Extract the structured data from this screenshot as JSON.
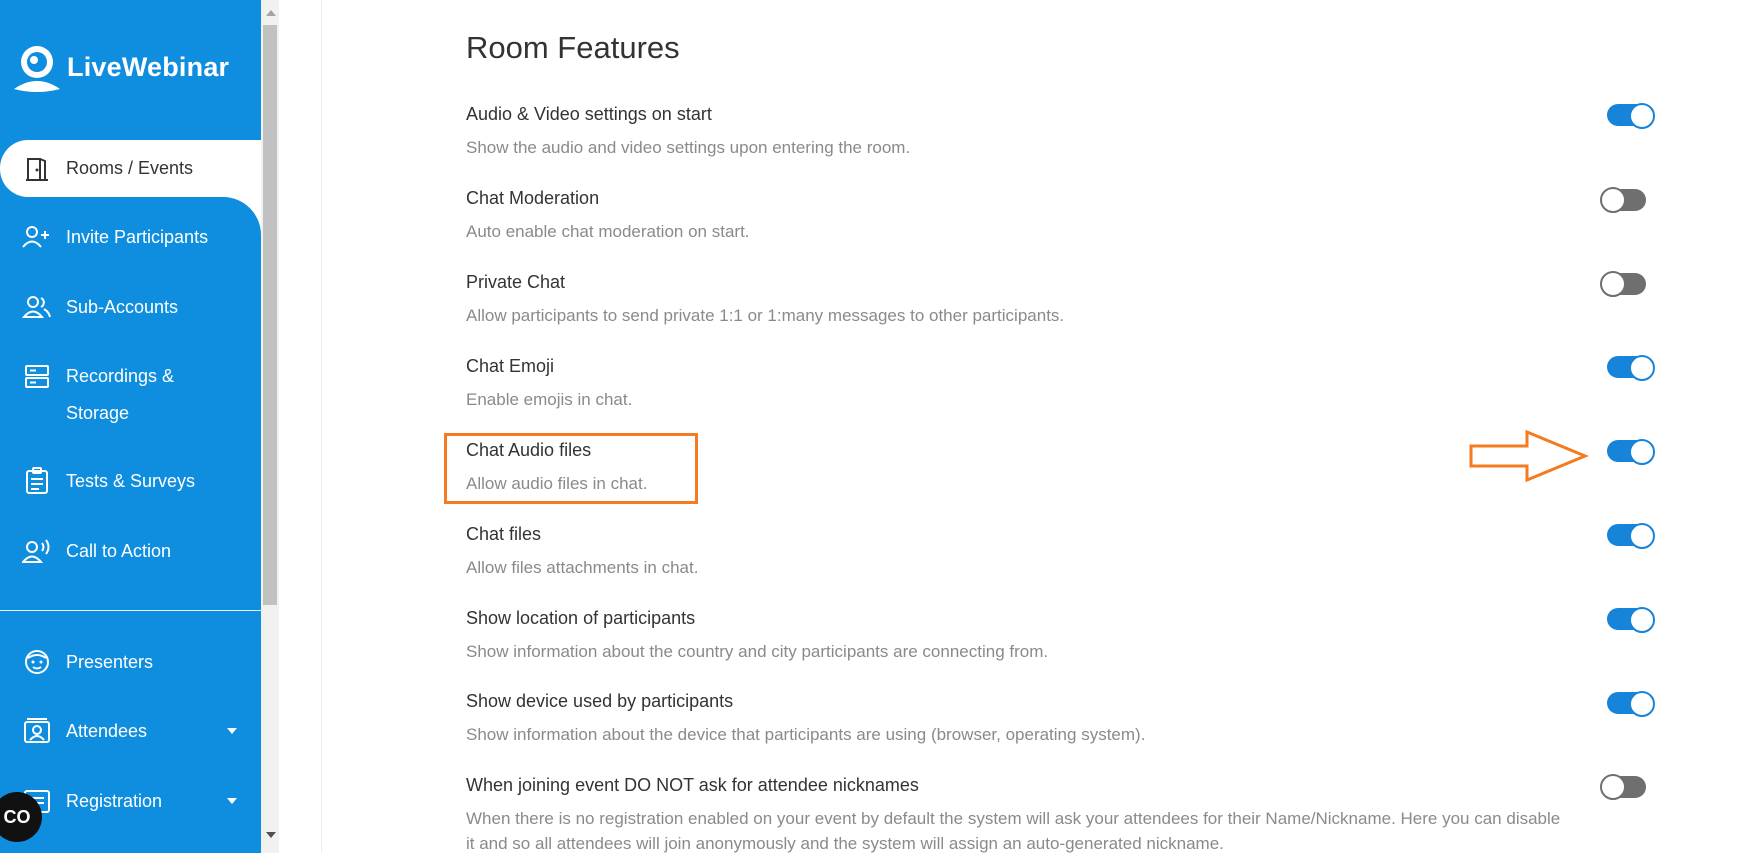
{
  "brand": {
    "name": "LiveWebinar"
  },
  "sidebar": {
    "items": [
      {
        "label": "Rooms / Events",
        "icon": "door-icon",
        "active": true
      },
      {
        "label": "Invite Participants",
        "icon": "add-user-icon"
      },
      {
        "label": "Sub-Accounts",
        "icon": "users-icon"
      },
      {
        "label": "Recordings &",
        "label2": "Storage",
        "icon": "storage-icon"
      },
      {
        "label": "Tests & Surveys",
        "icon": "clipboard-icon"
      },
      {
        "label": "Call to Action",
        "icon": "speaker-user-icon"
      },
      {
        "label": "Presenters",
        "icon": "presenter-icon"
      },
      {
        "label": "Attendees",
        "icon": "attendee-icon"
      },
      {
        "label": "Registration",
        "icon": "registration-icon"
      }
    ],
    "chat_widget": "CO"
  },
  "main": {
    "title": "Room Features",
    "features": [
      {
        "title": "Audio & Video settings on start",
        "desc": "Show the audio and video settings upon entering the room.",
        "enabled": true
      },
      {
        "title": "Chat Moderation",
        "desc": "Auto enable chat moderation on start.",
        "enabled": false
      },
      {
        "title": "Private Chat",
        "desc": "Allow participants to send private 1:1 or 1:many messages to other participants.",
        "enabled": false
      },
      {
        "title": "Chat Emoji",
        "desc": "Enable emojis in chat.",
        "enabled": true
      },
      {
        "title": "Chat Audio files",
        "desc": "Allow audio files in chat.",
        "enabled": true
      },
      {
        "title": "Chat files",
        "desc": "Allow files attachments in chat.",
        "enabled": true
      },
      {
        "title": "Show location of participants",
        "desc": "Show information about the country and city participants are connecting from.",
        "enabled": true
      },
      {
        "title": "Show device used by participants",
        "desc": "Show information about the device that participants are using (browser, operating system).",
        "enabled": true
      },
      {
        "title": "When joining event DO NOT ask for attendee nicknames",
        "desc": "When there is no registration enabled on your event by default the system will ask your attendees for their Name/Nickname. Here you can disable it and so all attendees will join anonymously and the system will assign an auto-generated nickname.",
        "enabled": false
      }
    ]
  },
  "colors": {
    "sidebar": "#0f8ee0",
    "toggle_on": "#1684d9",
    "toggle_off": "#6f6f6f",
    "annotation": "#f47b20"
  }
}
